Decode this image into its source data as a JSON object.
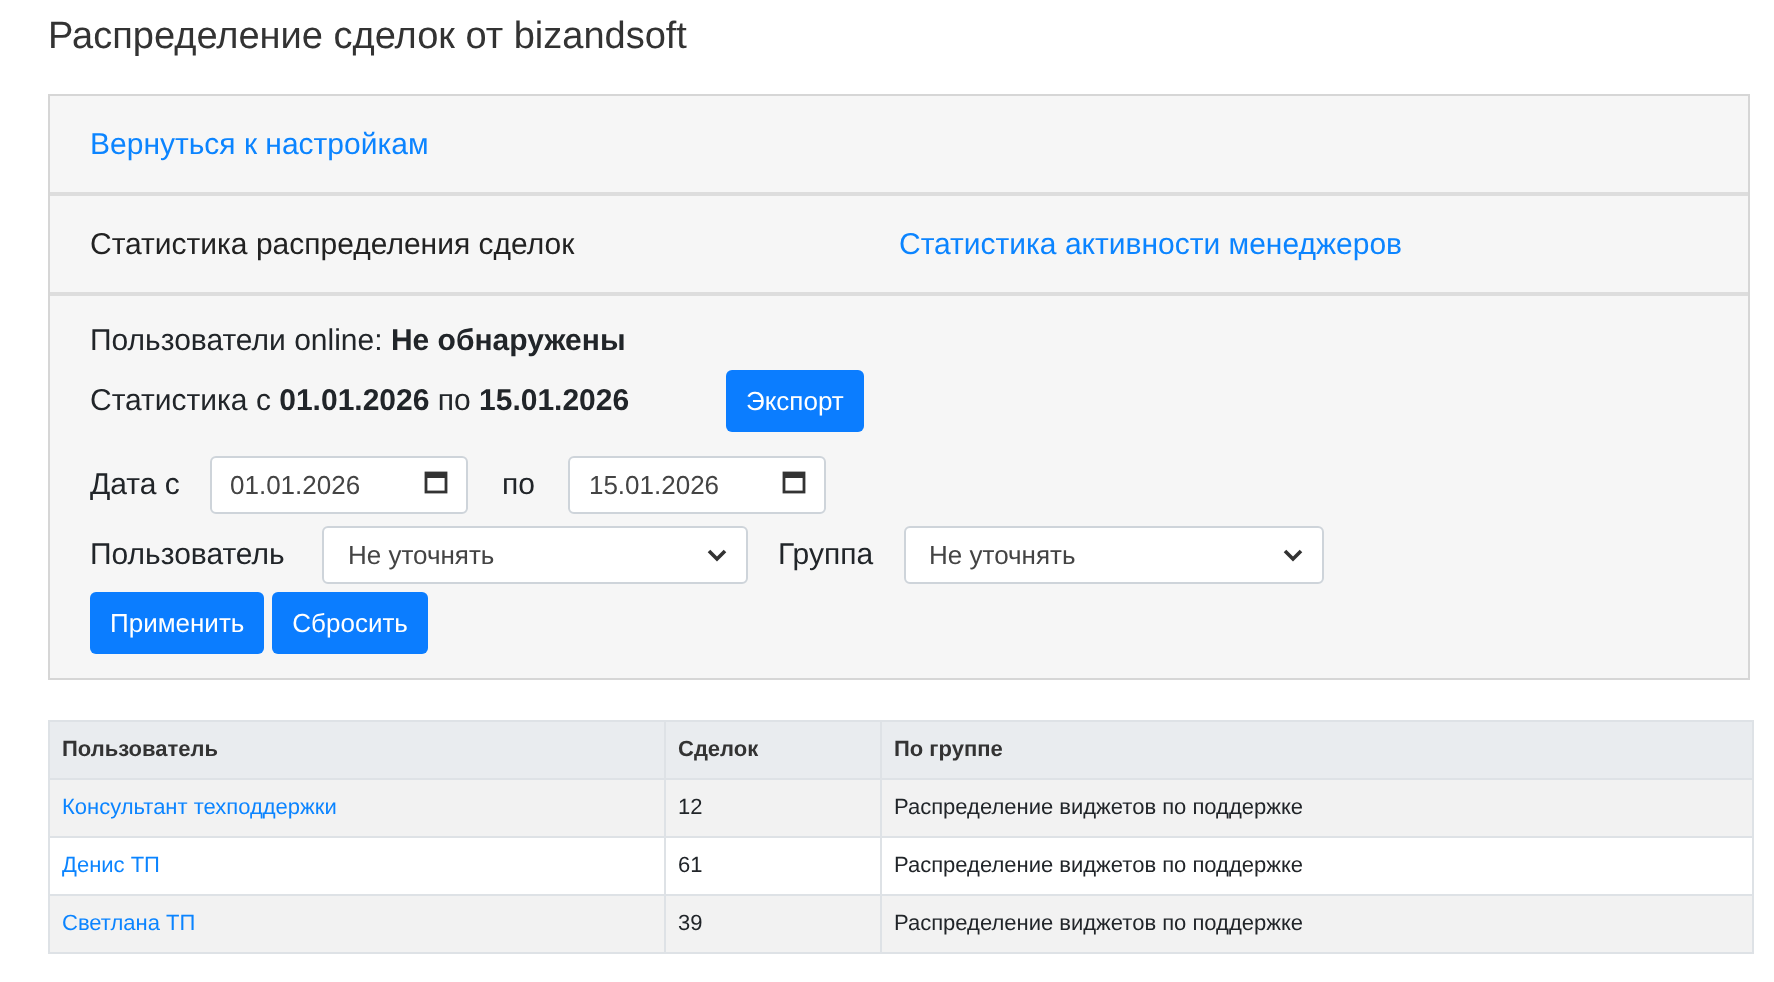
{
  "title": "Распределение сделок от bizandsoft",
  "back_link": "Вернуться к настройкам",
  "tabs": [
    {
      "label": "Статистика распределения сделок",
      "selected": true
    },
    {
      "label": "Статистика активности менеджеров",
      "selected": false
    }
  ],
  "filters": {
    "online": "Пользователи online: **Не обнаружены**",
    "period": "Статистика с **01.01.2026** по **15.01.2026**",
    "export_button": "Экспорт",
    "date_from_label": "Дата с",
    "date_from": "01.01.2026",
    "date_to_label": "по",
    "date_to": "15.01.2026",
    "user_label": "Пользователь",
    "user_value": "Не уточнять",
    "group_label": "Группа",
    "group_value": "Не уточнять",
    "apply_button": "Применить",
    "reset_button": "Сбросить"
  },
  "table": {
    "columns": [
      "Пользователь",
      "Сделок",
      "По группе"
    ],
    "rows": [
      {
        "user": "Консультант техподдержки",
        "deals": "12",
        "group": "Распределение виджетов по поддержке"
      },
      {
        "user": "Денис ТП",
        "deals": "61",
        "group": "Распределение виджетов по поддержке"
      },
      {
        "user": "Светлана ТП",
        "deals": "39",
        "group": "Распределение виджетов по поддержке"
      }
    ]
  }
}
